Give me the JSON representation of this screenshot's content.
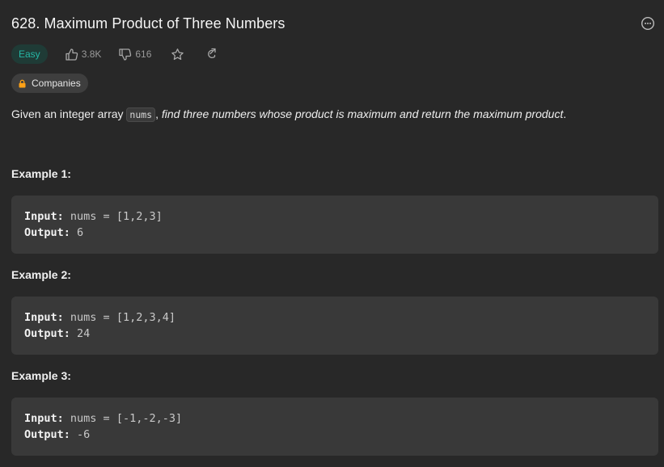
{
  "problem": {
    "title": "628. Maximum Product of Three Numbers",
    "difficulty": "Easy",
    "likes": "3.8K",
    "dislikes": "616",
    "companies_label": "Companies"
  },
  "description": {
    "prefix": "Given an integer array ",
    "code": "nums",
    "suffix_plain": ", ",
    "suffix_italic": "find three numbers whose product is maximum and return the maximum product",
    "end": "."
  },
  "examples": [
    {
      "title": "Example 1:",
      "input_label": "Input:",
      "input": "nums = [1,2,3]",
      "output_label": "Output:",
      "output": "6"
    },
    {
      "title": "Example 2:",
      "input_label": "Input:",
      "input": "nums = [1,2,3,4]",
      "output_label": "Output:",
      "output": "24"
    },
    {
      "title": "Example 3:",
      "input_label": "Input:",
      "input": "nums = [-1,-2,-3]",
      "output_label": "Output:",
      "output": "-6"
    }
  ],
  "icons": {
    "more": "more-horizontal-icon",
    "like": "thumbs-up-icon",
    "dislike": "thumbs-down-icon",
    "favorite": "star-icon",
    "share": "share-icon",
    "lock": "lock-icon"
  },
  "colors": {
    "background": "#282828",
    "easy_text": "#26b7a5",
    "easy_bg": "#1f3b36",
    "lock": "#ffa116",
    "code_block_bg": "#393939"
  }
}
